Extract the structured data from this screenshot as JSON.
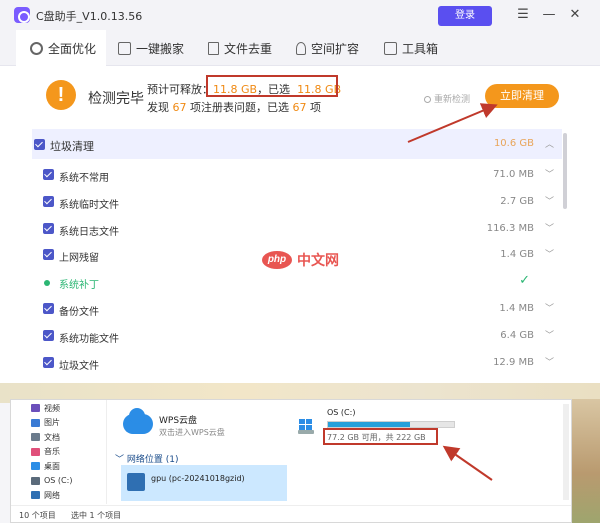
{
  "app": {
    "title": "C盘助手_V1.0.13.56",
    "login_label": "登录",
    "window_controls": {
      "menu": "☰",
      "minimize": "—",
      "close": "✕"
    }
  },
  "tabs": [
    {
      "label": "全面优化",
      "icon": "gear-icon",
      "active": true
    },
    {
      "label": "一键搬家",
      "icon": "box-icon",
      "active": false
    },
    {
      "label": "文件去重",
      "icon": "file-icon",
      "active": false
    },
    {
      "label": "空间扩容",
      "icon": "rocket-icon",
      "active": false
    },
    {
      "label": "工具箱",
      "icon": "toolbox-icon",
      "active": false
    }
  ],
  "status": {
    "title": "检测完毕",
    "line1_prefix": "预计可释放：",
    "releasable": "11.8 GB",
    "selected_label": "，已选",
    "selected": "11.8 GB",
    "line2_prefix": "发现",
    "found_count": "67",
    "line2_mid": "项注册表问题，已选",
    "selected_count": "67",
    "line2_suffix": "项",
    "rescan_label": "重新检测",
    "clean_button": "立即清理"
  },
  "junk": {
    "header": {
      "label": "垃圾清理",
      "size": "10.6 GB"
    },
    "items": [
      {
        "label": "系统不常用",
        "size": "71.0 MB",
        "state": "checked"
      },
      {
        "label": "系统临时文件",
        "size": "2.7 GB",
        "state": "checked"
      },
      {
        "label": "系统日志文件",
        "size": "116.3 MB",
        "state": "checked"
      },
      {
        "label": "上网残留",
        "size": "1.4 GB",
        "state": "checked"
      },
      {
        "label": "系统补丁",
        "size": "",
        "state": "done"
      },
      {
        "label": "备份文件",
        "size": "1.4 MB",
        "state": "checked"
      },
      {
        "label": "系统功能文件",
        "size": "6.4 GB",
        "state": "checked"
      },
      {
        "label": "垃圾文件",
        "size": "12.9 MB",
        "state": "checked"
      }
    ]
  },
  "watermark": {
    "badge": "php",
    "text": "中文网"
  },
  "explorer": {
    "sidebar": [
      {
        "label": "视频",
        "color": "#6b4fbb"
      },
      {
        "label": "图片",
        "color": "#3a7bd5"
      },
      {
        "label": "文档",
        "color": "#6b7b8c"
      },
      {
        "label": "音乐",
        "color": "#e04f7a"
      },
      {
        "label": "桌面",
        "color": "#2b8de6"
      },
      {
        "label": "OS (C:)",
        "color": "#5a6a7a"
      },
      {
        "label": "网络",
        "color": "#2f6fb2"
      }
    ],
    "cloud": {
      "name": "WPS云盘",
      "desc": "双击进入WPS云盘"
    },
    "drive": {
      "name": "OS (C:)",
      "free_text": "77.2 GB 可用，共 222 GB",
      "used_fraction": 0.65
    },
    "network": {
      "header": "网络位置 (1)",
      "item": "gpu (pc-20241018gzid)"
    },
    "status": {
      "count": "10 个项目",
      "selected": "选中 1 个项目"
    }
  },
  "colors": {
    "accent": "#f4971c",
    "brand": "#5a4ff0",
    "checkbox": "#4c57c8",
    "success": "#2bb673",
    "annotation": "#c0392b"
  }
}
